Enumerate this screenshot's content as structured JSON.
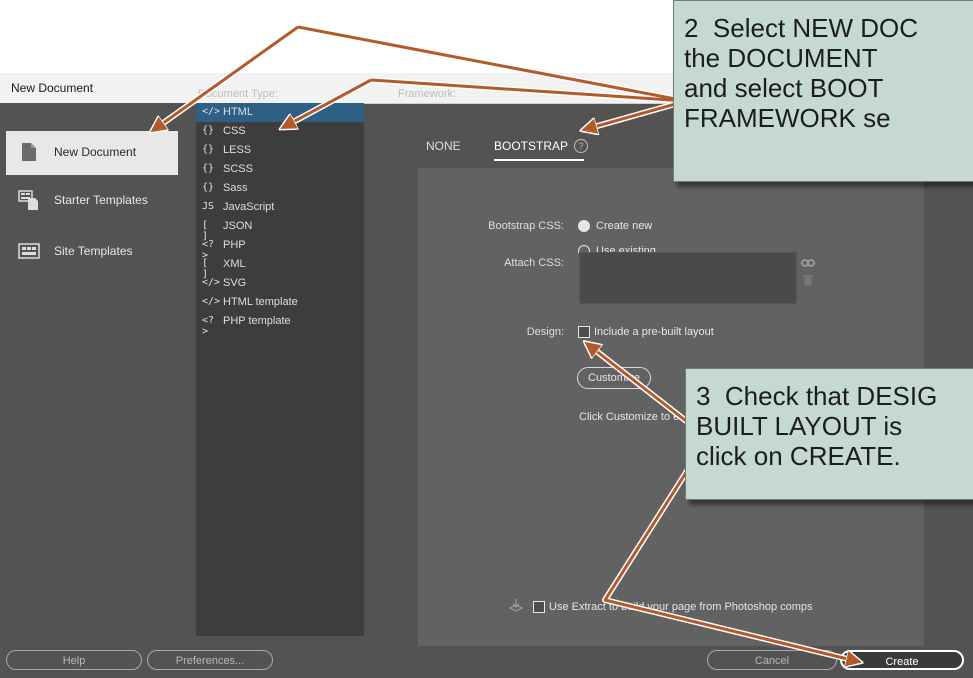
{
  "window": {
    "title": "New Document"
  },
  "sidebar": {
    "items": [
      {
        "label": "New Document",
        "icon": "document-icon",
        "selected": true
      },
      {
        "label": "Starter Templates",
        "icon": "starter-templates-icon",
        "selected": false
      },
      {
        "label": "Site Templates",
        "icon": "site-templates-icon",
        "selected": false
      }
    ]
  },
  "document_type": {
    "heading": "Document Type:",
    "items": [
      {
        "glyph": "</>",
        "label": "HTML",
        "selected": true
      },
      {
        "glyph": "{}",
        "label": "CSS"
      },
      {
        "glyph": "{}",
        "label": "LESS"
      },
      {
        "glyph": "{}",
        "label": "SCSS"
      },
      {
        "glyph": "{}",
        "label": "Sass"
      },
      {
        "glyph": "JS",
        "label": "JavaScript"
      },
      {
        "glyph": "[ ]",
        "label": "JSON"
      },
      {
        "glyph": "<?>",
        "label": "PHP"
      },
      {
        "glyph": "[ ]",
        "label": "XML"
      },
      {
        "glyph": "</>",
        "label": "SVG"
      },
      {
        "glyph": "</>",
        "label": "HTML template"
      },
      {
        "glyph": "<?>",
        "label": "PHP template"
      }
    ]
  },
  "framework": {
    "heading": "Framework:",
    "tabs": [
      {
        "label": "NONE",
        "active": false
      },
      {
        "label": "BOOTSTRAP",
        "active": true
      }
    ],
    "help_glyph": "?",
    "bootstrap_css_label": "Bootstrap CSS:",
    "option_create_new": "Create new",
    "option_use_existing": "Use existing",
    "selected_option": "Create new",
    "attach_css_label": "Attach CSS:",
    "design_label": "Design:",
    "include_layout_label": "Include a pre-built layout",
    "include_layout_checked": false,
    "customize_button": "Customize",
    "customize_hint": "Click Customize to e",
    "extract_checked": false,
    "extract_label": "Use Extract to build your page from Photoshop comps"
  },
  "footer": {
    "help": "Help",
    "preferences": "Preferences...",
    "cancel": "Cancel",
    "create": "Create"
  },
  "callouts": {
    "step2": "2  Select NEW DOC\nthe DOCUMENT\nand select BOOT\nFRAMEWORK se",
    "step3": "3  Check that DESIG\nBUILT LAYOUT is\nclick on CREATE."
  },
  "colors": {
    "dialog_bg": "#535353",
    "panel_bg": "#626262",
    "list_bg": "#3d3d3d",
    "selection": "#2e5f85",
    "callout_bg": "#c5d9d1",
    "arrow": "#b35a2c"
  }
}
